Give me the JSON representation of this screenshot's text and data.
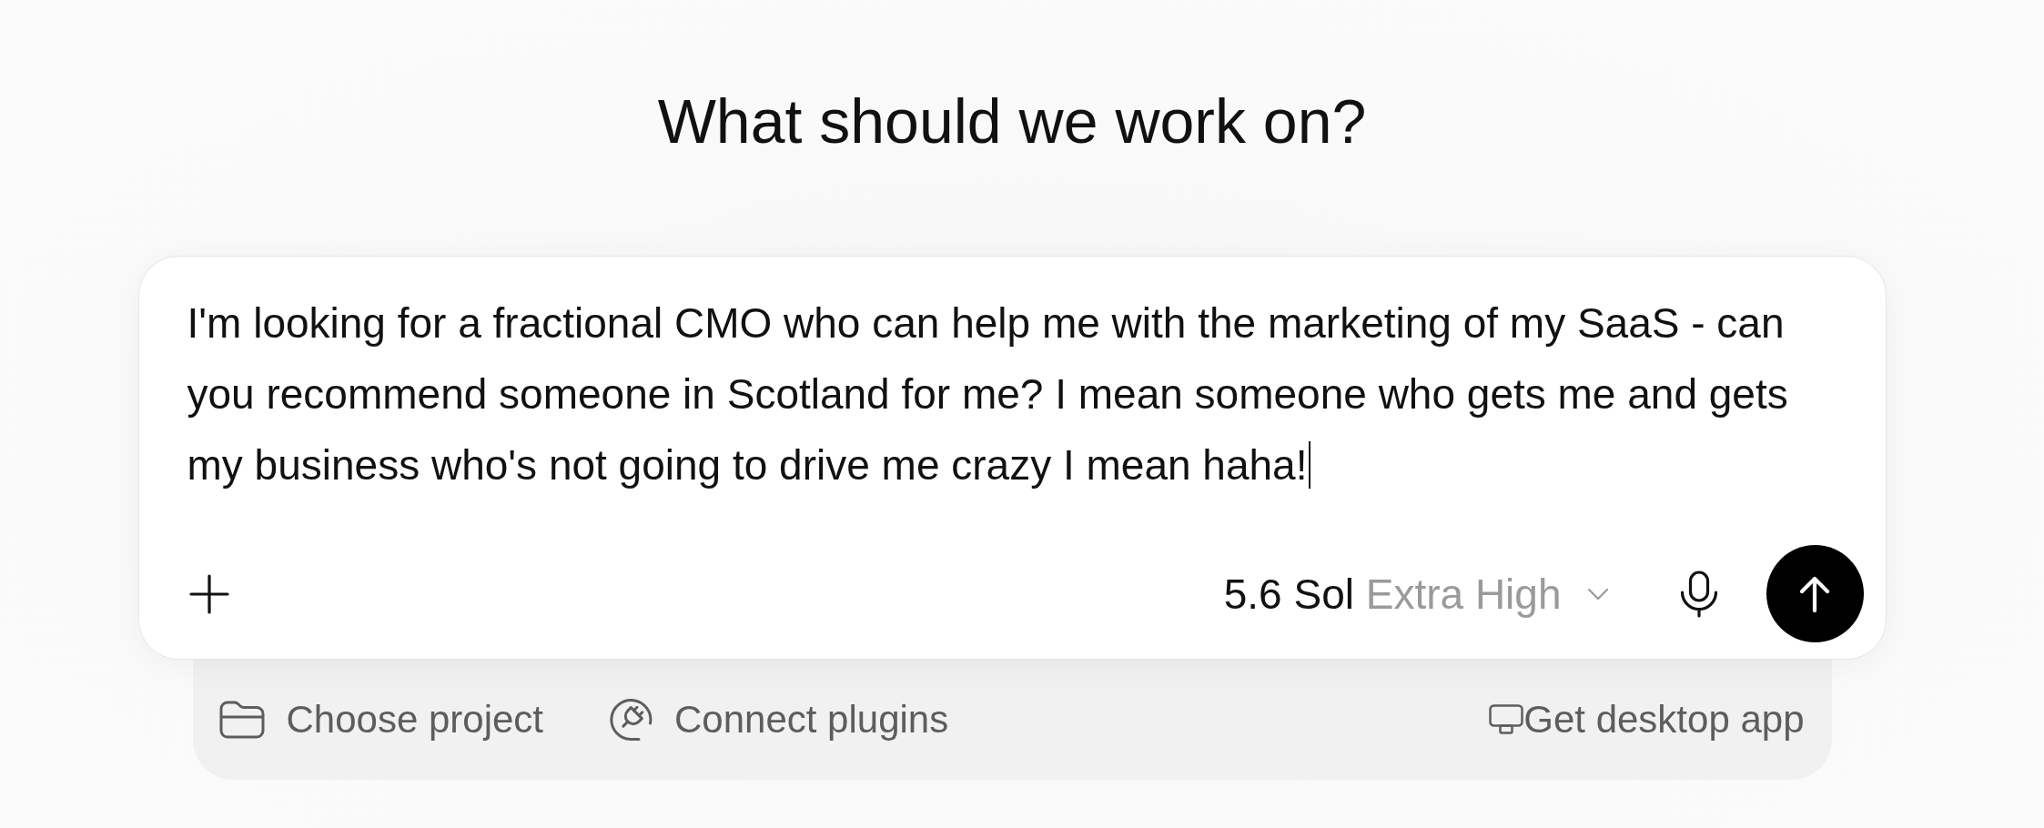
{
  "heading": "What should we work on?",
  "composer": {
    "message": "I'm looking for a fractional CMO who can help me with the marketing of my SaaS - can you recommend someone in Scotland for me? I mean someone who gets me and gets my business who's not going to drive me crazy I mean haha!",
    "focused": true,
    "model_selector": {
      "model": "5.6 Sol",
      "effort": "Extra High"
    }
  },
  "tray": {
    "actions": [
      {
        "kind": "project",
        "label": "Choose project"
      },
      {
        "kind": "plugins",
        "label": "Connect plugins"
      }
    ],
    "desktop_link": {
      "label": "Get desktop app"
    }
  }
}
